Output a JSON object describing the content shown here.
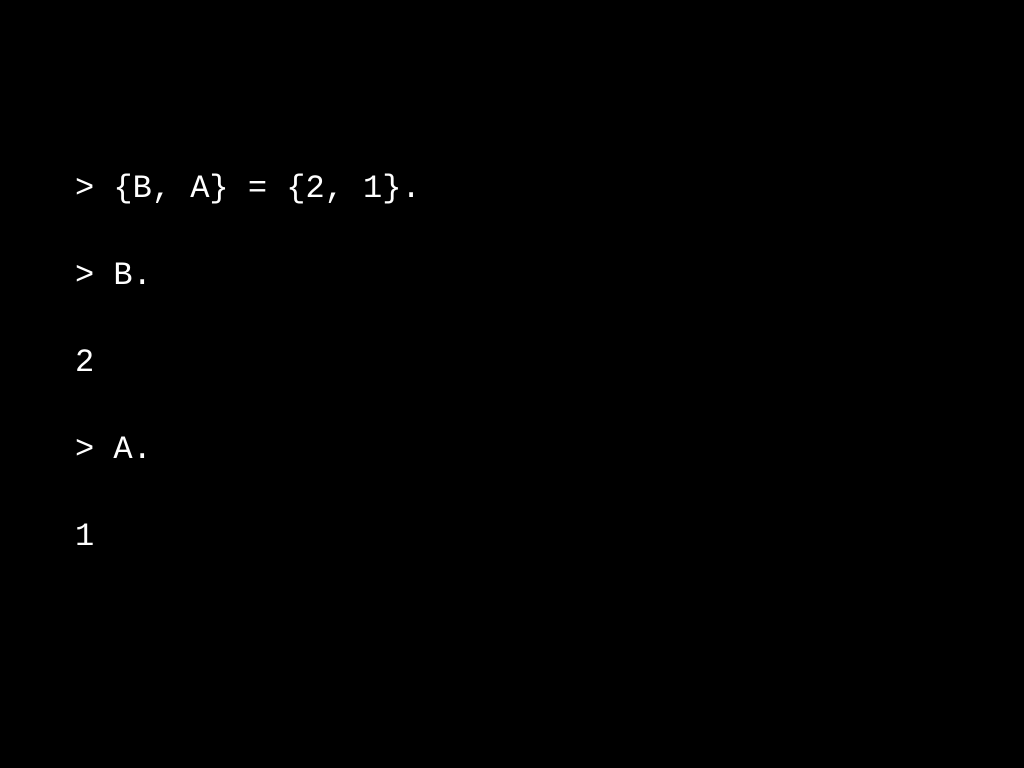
{
  "lines": [
    "> {B, A} = {2, 1}.",
    "> B.",
    "2",
    "> A.",
    "1"
  ]
}
